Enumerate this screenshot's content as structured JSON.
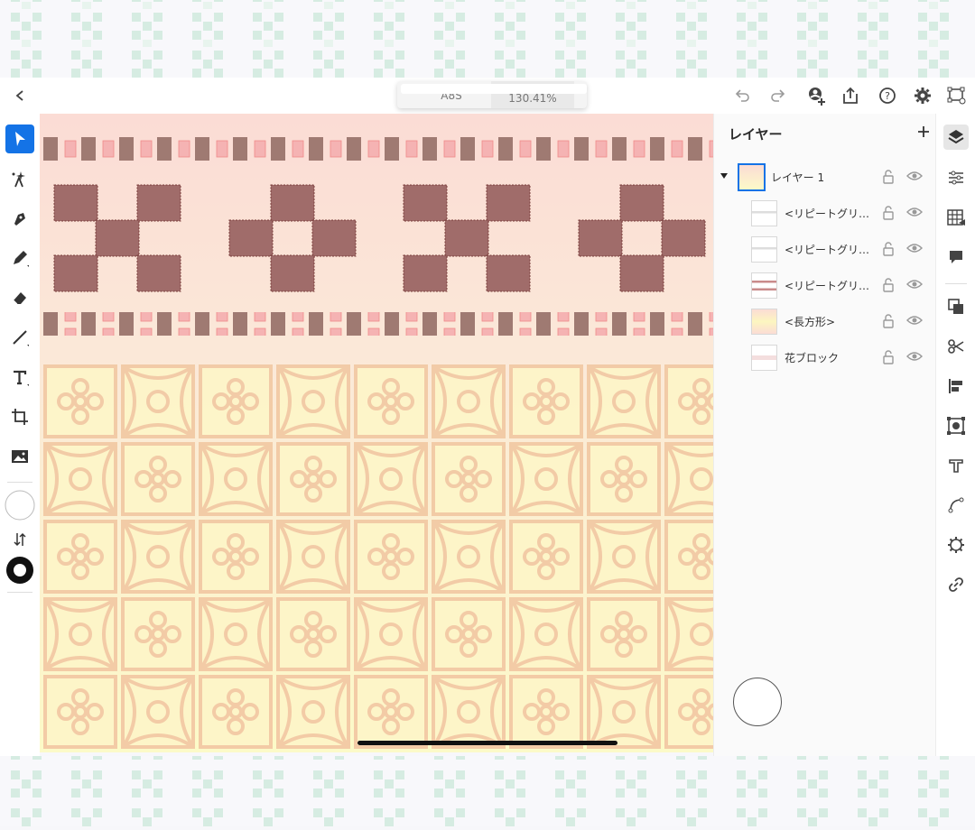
{
  "document": {
    "name": "A8S",
    "zoom": "130.41%"
  },
  "colors": {
    "accent": "#1473e6",
    "canvas_top": "#fbdcd5",
    "canvas_bottom": "#fcfac8",
    "motif": "#9f6b69",
    "tile_line": "#f2c9a4",
    "deco": "#d6ece2"
  },
  "topbar": {
    "left": [
      {
        "icon": "chevron-left-icon"
      }
    ],
    "right": [
      {
        "icon": "undo-icon"
      },
      {
        "icon": "redo-icon"
      },
      {
        "icon": "invite-person-icon"
      },
      {
        "icon": "share-export-icon"
      },
      {
        "icon": "help-icon"
      },
      {
        "icon": "settings-gear-icon"
      },
      {
        "icon": "preview-selection-icon"
      }
    ]
  },
  "tools": [
    {
      "icon": "selection-arrow-icon",
      "active": true
    },
    {
      "icon": "direct-select-sparkle-icon"
    },
    {
      "icon": "pen-nib-icon"
    },
    {
      "icon": "pencil-icon"
    },
    {
      "icon": "eraser-icon"
    },
    {
      "icon": "line-icon"
    },
    {
      "icon": "text-tool-icon"
    },
    {
      "icon": "crop-transform-icon"
    },
    {
      "icon": "image-icon"
    },
    {
      "icon": "fill-swatch-icon"
    },
    {
      "icon": "swap-colors-icon"
    },
    {
      "icon": "stroke-swatch-icon"
    }
  ],
  "layers_panel": {
    "title": "レイヤー",
    "add_icon": "plus-icon",
    "rows": [
      {
        "name": "レイヤー 1",
        "expanded": true
      },
      {
        "name": "<リピートグリ…"
      },
      {
        "name": "<リピートグリ…"
      },
      {
        "name": "<リピートグリ…"
      },
      {
        "name": "<長方形>"
      },
      {
        "name": "花ブロック"
      }
    ]
  },
  "right_panel": [
    {
      "icon": "layers-stack-icon",
      "active": true
    },
    {
      "icon": "properties-sliders-icon"
    },
    {
      "icon": "grid-table-icon"
    },
    {
      "icon": "comment-bubble-icon"
    },
    {
      "icon": "arrange-icon"
    },
    {
      "icon": "scissors-icon"
    },
    {
      "icon": "align-left-icon"
    },
    {
      "icon": "symbol-frame-icon"
    },
    {
      "icon": "type-t-icon"
    },
    {
      "icon": "path-curve-icon"
    },
    {
      "icon": "gear-shape-icon"
    },
    {
      "icon": "link-icon"
    }
  ]
}
